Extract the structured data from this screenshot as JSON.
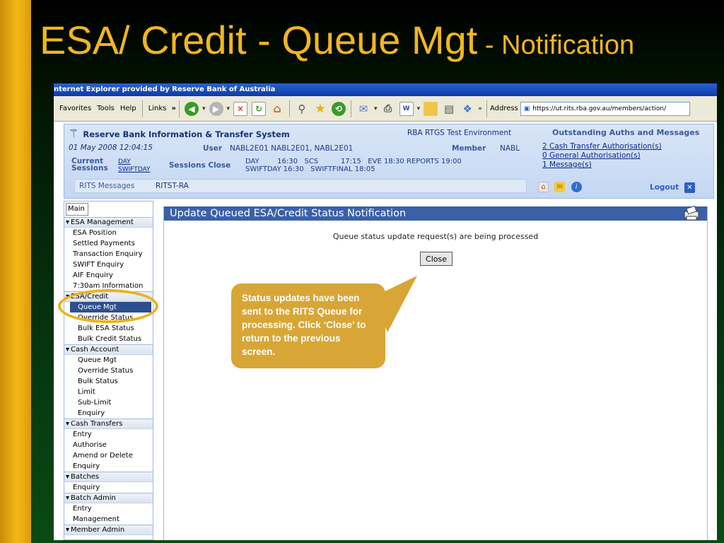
{
  "slide": {
    "title_main": "ESA/ Credit - Queue Mgt",
    "title_sub": " - Notification"
  },
  "browser": {
    "title": "nternet Explorer provided by Reserve Bank of Australia",
    "menu": [
      "Favorites",
      "Tools",
      "Help",
      "Links"
    ],
    "address_label": "Address",
    "address_url": "https://ut.rits.rba.gov.au/members/action/"
  },
  "rits_header": {
    "system_name": "Reserve Bank Information & Transfer System",
    "environment": "RBA RTGS Test Environment",
    "outstanding_title": "Outstanding Auths and Messages",
    "datetime": "01 May 2008 12:04:15",
    "user_label": "User",
    "user_value": "NABL2E01 NABL2E01, NABL2E01",
    "member_label": "Member",
    "member_value": "NABL",
    "outstanding_links": [
      "2 Cash Transfer Authorisation(s)",
      "0 General Authorisation(s)",
      "1 Message(s)"
    ],
    "current_sessions_label": "Current Sessions",
    "current_sessions": [
      "DAY",
      "SWIFTDAY"
    ],
    "sessions_close_label": "Sessions Close",
    "sessions_close_line1": "DAY        16:30   SCS          17:15   EVE 18:30 REPORTS 19:00",
    "sessions_close_line2": "SWIFTDAY 16:30   SWIFTFINAL 18:05",
    "messages_label": "RITS Messages",
    "messages_value": "RITST-RA",
    "logout_label": "Logout"
  },
  "sidebar": {
    "main_tab": "Main",
    "sections": [
      {
        "header": "ESA Management",
        "items": [
          "ESA Position",
          "Settled Payments",
          "Transaction Enquiry",
          "SWIFT Enquiry",
          "AIF Enquiry",
          "7:30am Information"
        ]
      },
      {
        "header": "ESA/Credit",
        "items": [
          "Queue Mgt",
          "Override Status",
          "Bulk ESA Status",
          "Bulk Credit Status"
        ]
      },
      {
        "header": "Cash Account",
        "items": [
          "Queue Mgt",
          "Override Status",
          "Bulk Status",
          "Limit",
          "Sub-Limit",
          "Enquiry"
        ]
      },
      {
        "header": "Cash Transfers",
        "items": [
          "Entry",
          "Authorise",
          "Amend or Delete",
          "Enquiry"
        ]
      },
      {
        "header": "Batches",
        "items": [
          "Enquiry"
        ]
      },
      {
        "header": "Batch Admin",
        "items": [
          "Entry",
          "Management"
        ]
      },
      {
        "header": "Member Admin",
        "items": []
      }
    ]
  },
  "content": {
    "header": "Update Queued ESA/Credit Status Notification",
    "status_text": "Queue status update request(s) are being processed",
    "close_label": "Close"
  },
  "callout": {
    "text": "Status updates have been sent to the RITS Queue for processing. Click ‘Close’ to return to the previous screen."
  },
  "colors": {
    "title_gold": "#f2b620",
    "callout_gold": "#d8a636",
    "header_blue": "#3b60a8"
  }
}
